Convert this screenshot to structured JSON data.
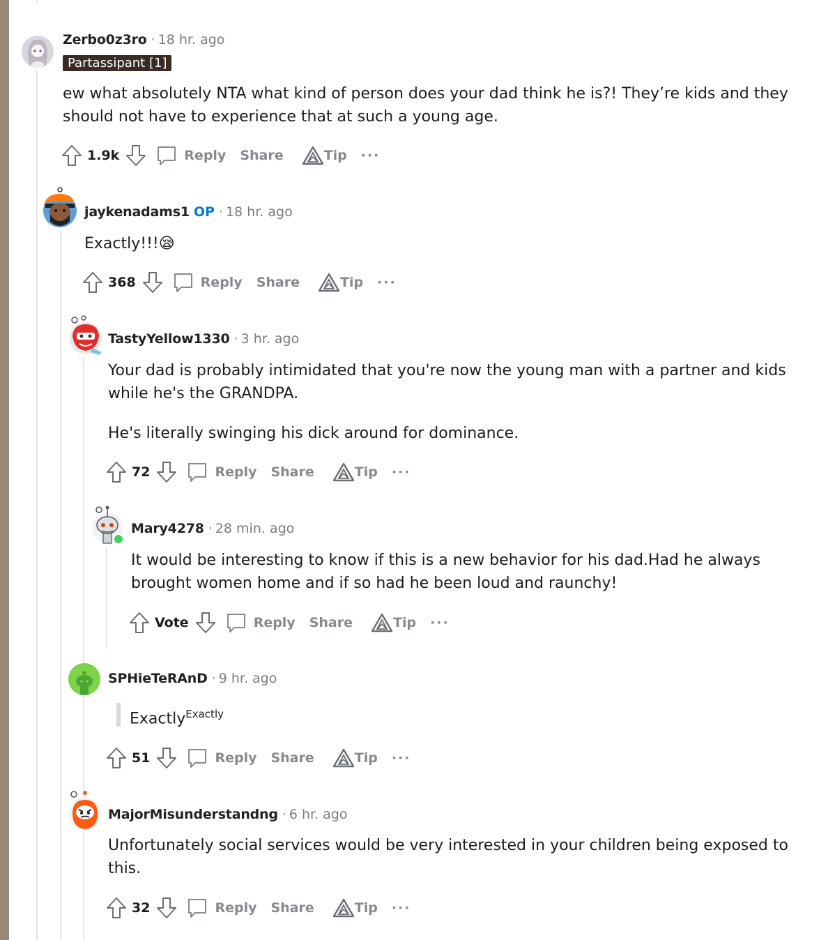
{
  "comments": [
    {
      "username": "Zerbo0z3ro",
      "time": "18 hr. ago",
      "flair": "Partassipant [1]",
      "body": [
        "ew what absolutely NTA what kind of person does your dad think he is?! They’re kids and they",
        "should not have to experience that at such a young age."
      ],
      "score": "1.9k"
    },
    {
      "username": "jaykenadams1",
      "op": "OP",
      "time": "18 hr. ago",
      "body": [
        "Exactly!!!😪"
      ],
      "score": "368"
    },
    {
      "username": "TastyYellow1330",
      "time": "3 hr. ago",
      "body": [
        "Your dad is probably intimidated that you're now the young man with a partner and kids",
        "while he's the GRANDPA.",
        "He's literally swinging his dick around for dominance."
      ],
      "score": "72"
    },
    {
      "username": "Mary4278",
      "time": "28 min. ago",
      "body": [
        "It would be interesting to know if this is a new behavior for his dad.Had he always",
        "brought women home and if so had he been loud and raunchy!"
      ],
      "score": "Vote"
    },
    {
      "username": "SPHieTeRAnD",
      "time": "9 hr. ago",
      "quote_main": "Exactly",
      "quote_sup": "Exactly",
      "score": "51"
    },
    {
      "username": "MajorMisunderstandng",
      "time": "6 hr. ago",
      "body": [
        "Unfortunately social services would be very interested in your children being exposed to",
        "this."
      ],
      "score": "32"
    }
  ],
  "actions": {
    "reply": "Reply",
    "share": "Share",
    "tip": "Tip",
    "more": "···"
  },
  "meta_separator": "·",
  "icons": {
    "upvote": "arrow-up-outline-icon",
    "downvote": "arrow-down-outline-icon",
    "reply": "speech-bubble-icon",
    "tip": "triangle-award-icon",
    "more": "ellipsis-icon"
  },
  "colors": {
    "op": "#0079d3",
    "flair_bg": "#3a2c24",
    "muted": "#878a8c",
    "online": "#46d160"
  }
}
